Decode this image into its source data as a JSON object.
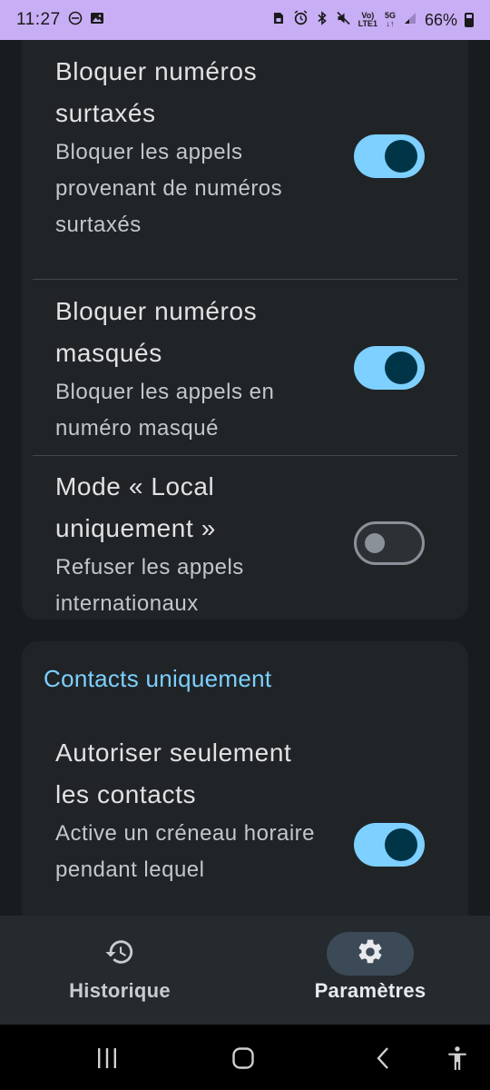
{
  "status_bar": {
    "time": "11:27",
    "icons_left": [
      "do-not-disturb-icon",
      "image-icon"
    ],
    "icons_right": [
      "sim-icon",
      "alarm-icon",
      "bluetooth-icon",
      "mute-icon"
    ],
    "volte_line1": "Vo)",
    "volte_line2": "LTE1",
    "network_line1": "5G",
    "network_line2": "↓↑",
    "battery": "66%"
  },
  "cards": [
    {
      "settings": [
        {
          "title": "Bloquer numéros surtaxés",
          "description": "Bloquer les appels provenant de numéros surtaxés",
          "enabled": true
        },
        {
          "title": "Bloquer numéros masqués",
          "description": "Bloquer les appels en numéro masqué",
          "enabled": true
        },
        {
          "title": "Mode « Local uniquement »",
          "description": "Refuser les appels internationaux",
          "enabled": false
        }
      ]
    },
    {
      "header": "Contacts uniquement",
      "settings": [
        {
          "title": "Autoriser seulement les contacts",
          "description": "Active un créneau horaire pendant lequel",
          "enabled": true
        }
      ]
    }
  ],
  "bottom_nav": {
    "items": [
      {
        "label": "Historique",
        "icon": "history-icon",
        "selected": false
      },
      {
        "label": "Paramètres",
        "icon": "gear-icon",
        "selected": true
      }
    ]
  },
  "system_nav": [
    "recents-icon",
    "home-icon",
    "back-icon",
    "accessibility-icon"
  ],
  "colors": {
    "accent": "#7dd0ff",
    "status_bar": "#c8aef5",
    "background": "#191c1e",
    "card": "#202427"
  }
}
